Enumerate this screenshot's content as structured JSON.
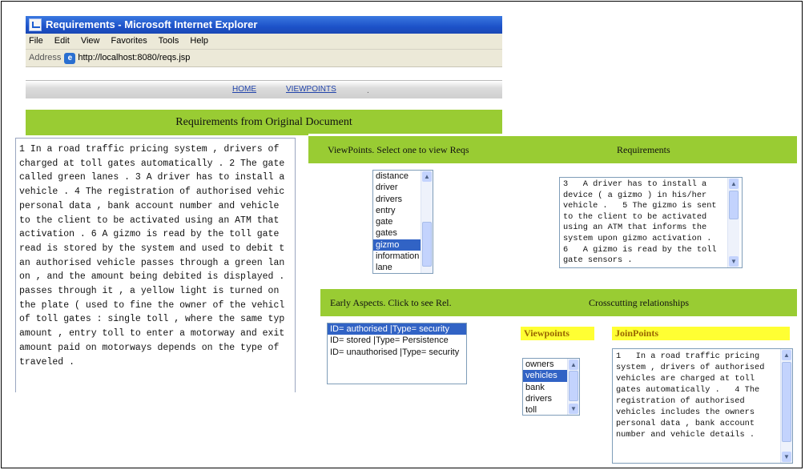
{
  "browser": {
    "title": "Requirements - Microsoft Internet Explorer",
    "menu": [
      "File",
      "Edit",
      "View",
      "Favorites",
      "Tools",
      "Help"
    ],
    "address_label": "Address",
    "address_url": "http://localhost:8080/reqs.jsp",
    "nav": {
      "home": "HOME",
      "viewpoints": "VIEWPOINTS",
      "dot": "."
    }
  },
  "document": {
    "heading": "Requirements from Original Document",
    "lines": [
      "1 In a road traffic pricing system , drivers of",
      "charged at toll gates automatically . 2 The gate",
      "called green lanes . 3 A driver has to install a",
      "vehicle . 4 The registration of authorised vehic",
      "personal data , bank account number and vehicle",
      "to the client to be activated using an ATM that",
      "activation . 6 A gizmo is read by the toll gate",
      "read is stored by the system and used to debit t",
      "an authorised vehicle passes through a green lan",
      "on , and the amount being debited is displayed .",
      "passes through it , a yellow light is turned on",
      "the plate ( used to fine the owner of the vehicl",
      "of toll gates : single toll , where the same typ",
      "amount , entry toll to enter a motorway and exit",
      "amount paid on motorways depends on the type of",
      "traveled ."
    ]
  },
  "viewpoints_panel": {
    "title": "ViewPoints. Select one to view Reqs",
    "req_title": "Requirements",
    "list": [
      "distance",
      "driver",
      "drivers",
      "entry",
      "gate",
      "gates",
      "gizmo",
      "information",
      "lane"
    ],
    "selected": "gizmo",
    "req_lines": [
      "3   A driver has to install a",
      "device ( a gizmo ) in his/her",
      "vehicle .   5 The gizmo is sent",
      "to the client to be activated",
      "using an ATM that informs the",
      "system upon gizmo activation .",
      "6   A gizmo is read by the toll",
      "gate sensors ."
    ]
  },
  "aspects_panel": {
    "title": "Early Aspects. Click to see Rel.",
    "cross_title": "Crosscutting relationships",
    "aspects": [
      "ID= authorised |Type= security",
      "ID= stored |Type= Persistence",
      "ID= unauthorised |Type= security"
    ],
    "selected_aspect": "ID= authorised |Type= security",
    "viewpoints_label": "Viewpoints",
    "joinpoints_label": "JoinPoints",
    "vp_list": [
      "owners",
      "vehicles",
      "bank",
      "drivers",
      "toll"
    ],
    "vp_selected": "vehicles",
    "jp_lines": [
      "1   In a road traffic pricing",
      "system , drivers of authorised",
      "vehicles are charged at toll",
      "gates automatically .   4 The",
      "registration of authorised",
      "vehicles includes the owners",
      "personal data , bank account",
      "number and vehicle details ."
    ]
  },
  "colors": {
    "green": "#99cc33",
    "yellow": "#ffff33",
    "selection": "#3163c5"
  }
}
